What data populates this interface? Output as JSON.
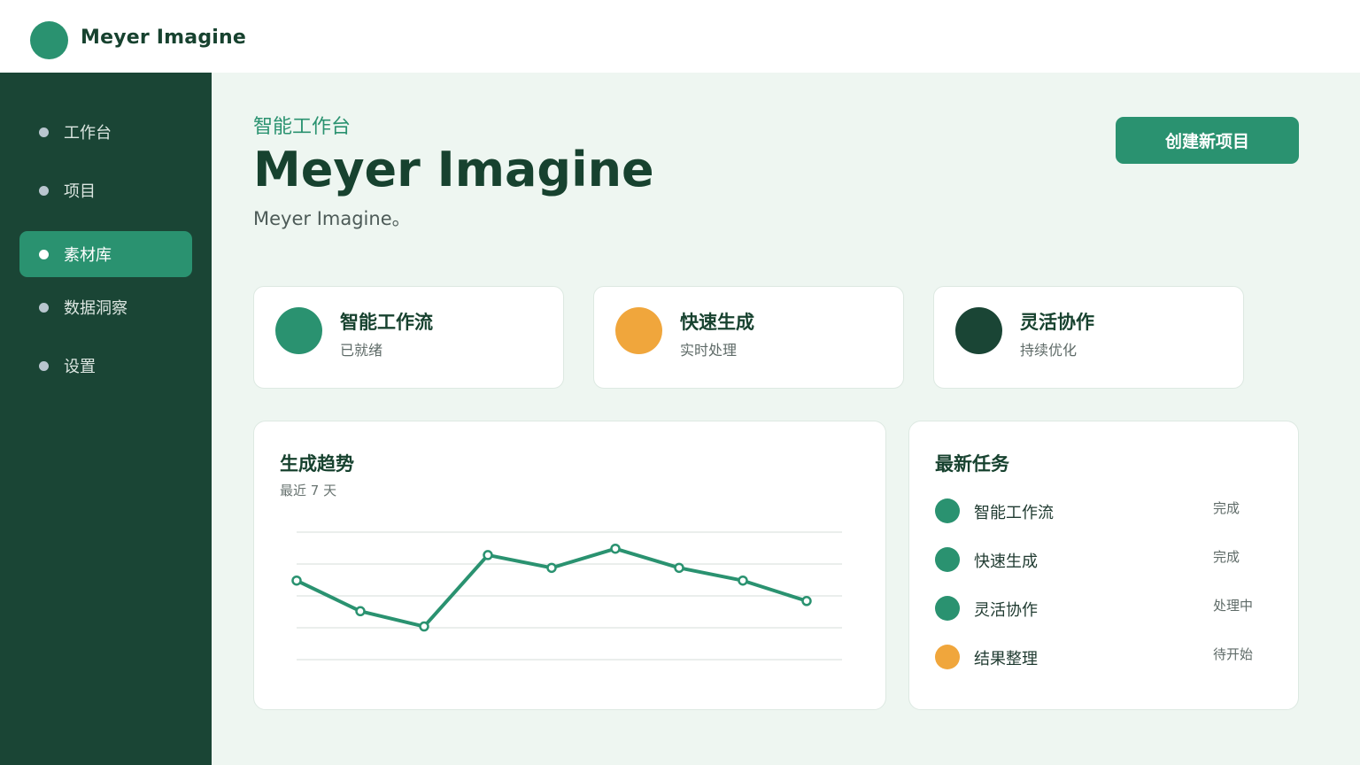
{
  "app": {
    "brand": "Meyer Imagine"
  },
  "colors": {
    "primary": "#2a9270",
    "dark": "#1a4535",
    "accent": "#f0a63c",
    "deep": "#1a4535"
  },
  "sidebar": {
    "items": [
      {
        "label": "工作台",
        "active": false
      },
      {
        "label": "项目",
        "active": false
      },
      {
        "label": "素材库",
        "active": true
      },
      {
        "label": "数据洞察",
        "active": false
      },
      {
        "label": "设置",
        "active": false
      }
    ]
  },
  "header": {
    "eyebrow": "智能工作台",
    "title": "Meyer Imagine",
    "subtitle": "Meyer Imagine。",
    "create_button": "创建新项目"
  },
  "stats": [
    {
      "title": "智能工作流",
      "sub": "已就绪",
      "color": "#2a9270"
    },
    {
      "title": "快速生成",
      "sub": "实时处理",
      "color": "#f0a63c"
    },
    {
      "title": "灵活协作",
      "sub": "持续优化",
      "color": "#1a4535"
    }
  ],
  "trend": {
    "title": "生成趋势",
    "subtitle": "最近 7 天"
  },
  "chart_data": {
    "type": "line",
    "x": [
      1,
      2,
      3,
      4,
      5,
      6,
      7,
      8,
      9
    ],
    "series": [
      {
        "values": [
          62,
          38,
          26,
          82,
          72,
          87,
          72,
          62,
          46
        ]
      }
    ],
    "ylim": [
      0,
      100
    ],
    "grid": true,
    "color": "#2a9270"
  },
  "tasks": {
    "title": "最新任务",
    "items": [
      {
        "name": "智能工作流",
        "status": "完成",
        "color": "#2a9270"
      },
      {
        "name": "快速生成",
        "status": "完成",
        "color": "#2a9270"
      },
      {
        "name": "灵活协作",
        "status": "处理中",
        "color": "#2a9270"
      },
      {
        "name": "结果整理",
        "status": "待开始",
        "color": "#f0a63c"
      }
    ]
  }
}
